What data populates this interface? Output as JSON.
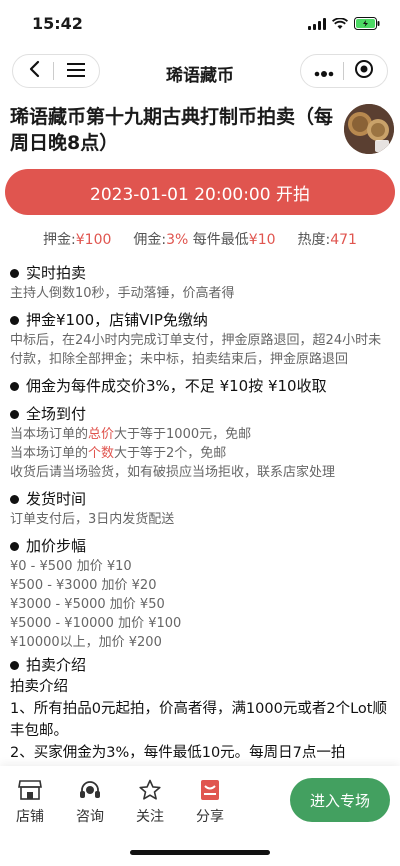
{
  "status_bar": {
    "time": "15:42"
  },
  "nav": {
    "title": "琋语藏币"
  },
  "header": {
    "title": "琋语藏币第十九期古典打制币拍卖（每周日晚8点）"
  },
  "start_button_label": "2023-01-01 20:00:00 开拍",
  "stats": {
    "deposit_label": "押金:",
    "deposit_value": "¥100",
    "commission_label": "佣金:",
    "commission_value": "3%",
    "min_label": "每件最低",
    "min_value": "¥10",
    "heat_label": "热度:",
    "heat_value": "471"
  },
  "sections": {
    "realtime": {
      "title": "实时拍卖",
      "body": "主持人倒数10秒，手动落锤，价高者得"
    },
    "deposit": {
      "title": "押金¥100，店铺VIP免缴纳",
      "body": "中标后，在24小时内完成订单支付，押金原路退回，超24小时未付款，扣除全部押金；未中标，拍卖结束后，押金原路退回"
    },
    "commission": {
      "title": "佣金为每件成交价3%，不足 ¥10按 ¥10收取"
    },
    "shipping_free": {
      "title": "全场到付",
      "line1_a": "当本场订单的",
      "line1_hl": "总价",
      "line1_b": "大于等于1000元，免邮",
      "line2_a": "当本场订单的",
      "line2_hl": "个数",
      "line2_b": "大于等于2个，免邮",
      "line3": "收货后请当场验货，如有破损应当场拒收，联系店家处理"
    },
    "delivery": {
      "title": "发货时间",
      "body": "订单支付后，3日内发货配送"
    },
    "increments": {
      "title": "加价步幅",
      "lines": [
        "¥0 - ¥500 加价 ¥10",
        "¥500 - ¥3000 加价 ¥20",
        "¥3000 - ¥5000 加价 ¥50",
        "¥5000 - ¥10000 加价 ¥100",
        "¥10000以上，加价 ¥200"
      ]
    },
    "intro": {
      "title": "拍卖介绍",
      "lines": [
        "拍卖介绍",
        "1、所有拍品0元起拍，价高者得，满1000元或者2个Lot顺丰包邮。",
        "2、买家佣金为3%，每件最低10元。每周日7点一拍"
      ]
    }
  },
  "bottom_bar": {
    "tabs": [
      {
        "label": "店铺",
        "icon": "shop-icon"
      },
      {
        "label": "咨询",
        "icon": "headset-icon"
      },
      {
        "label": "关注",
        "icon": "star-icon"
      },
      {
        "label": "分享",
        "icon": "share-icon"
      }
    ],
    "enter_label": "进入专场"
  },
  "colors": {
    "accent_red": "#e0554f",
    "accent_green": "#43a060"
  }
}
